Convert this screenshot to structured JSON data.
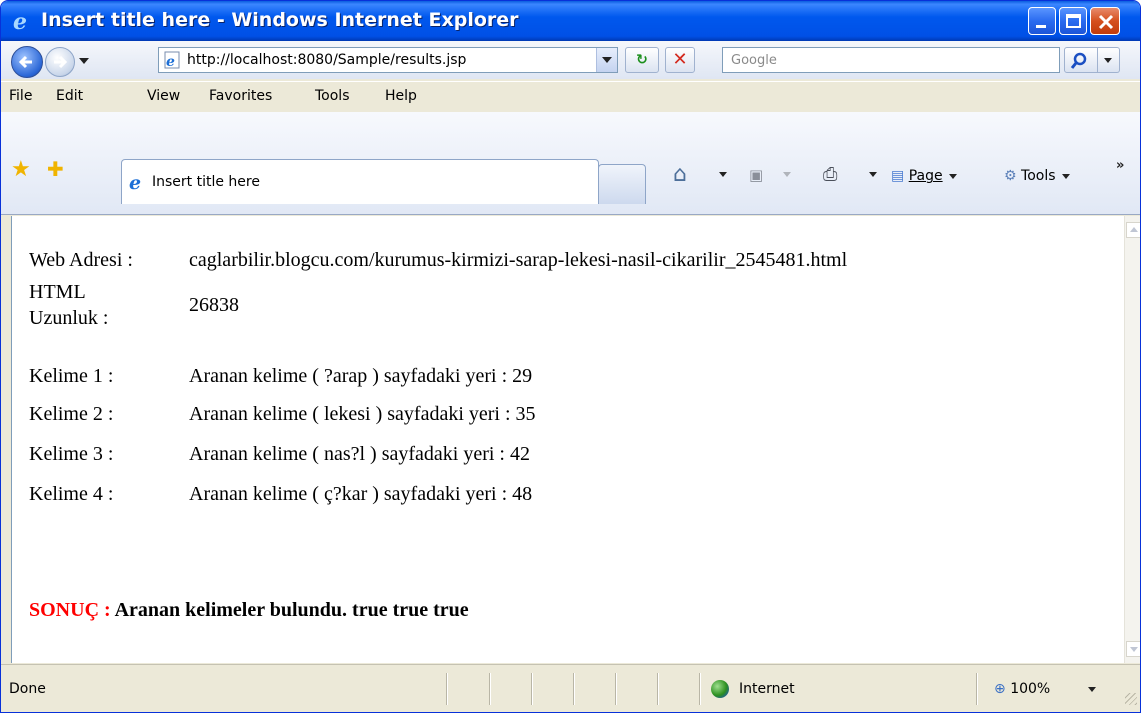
{
  "window": {
    "title": "Insert title here - Windows Internet Explorer"
  },
  "addressbar": {
    "url": "http://localhost:8080/Sample/results.jsp",
    "search_placeholder": "Google"
  },
  "menu": {
    "items": [
      "File",
      "Edit",
      "View",
      "Favorites",
      "Tools",
      "Help"
    ]
  },
  "tabs": {
    "active_label": "Insert title here"
  },
  "commands": {
    "page_label": "Page",
    "tools_label": "Tools"
  },
  "content": {
    "rows": [
      {
        "label": "Web Adresi :",
        "value": "caglarbilir.blogcu.com/kurumus-kirmizi-sarap-lekesi-nasil-cikarilir_2545481.html"
      },
      {
        "label": "HTML",
        "label2": "Uzunluk :",
        "value": "26838"
      },
      {
        "label": "Kelime 1 :",
        "value": "Aranan kelime ( ?arap ) sayfadaki yeri : 29"
      },
      {
        "label": "Kelime 2 :",
        "value": "Aranan kelime ( lekesi ) sayfadaki yeri : 35"
      },
      {
        "label": "Kelime 3 :",
        "value": "Aranan kelime ( nas?l ) sayfadaki yeri : 42"
      },
      {
        "label": "Kelime 4 :",
        "value": "Aranan kelime ( ç?kar ) sayfadaki yeri : 48"
      }
    ],
    "result_label": "SONUÇ :",
    "result_text": "Aranan kelimeler bulundu. true true true"
  },
  "status": {
    "text": "Done",
    "zone": "Internet",
    "zoom": "100%"
  },
  "colors": {
    "titlebar": "#0058ee",
    "result_label": "#ff0000"
  }
}
